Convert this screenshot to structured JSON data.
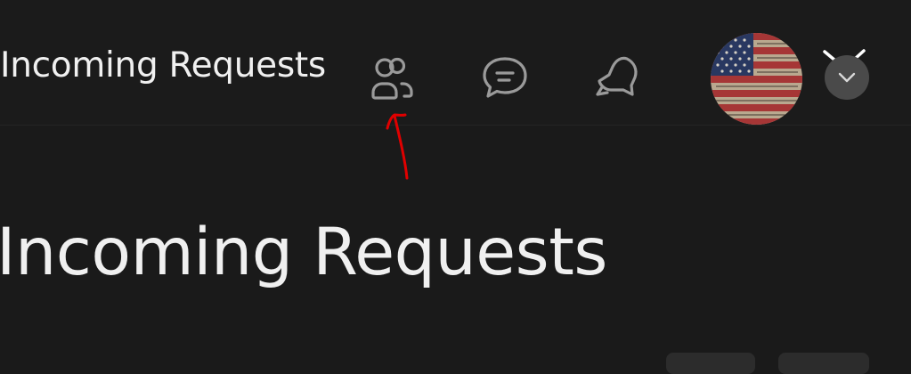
{
  "header": {
    "title": "Incoming Requests",
    "icons": {
      "friends": "friends-icon",
      "chat": "chat-icon",
      "notifications": "bell-icon",
      "avatar": "user-avatar",
      "dropdown": "chevron-down-icon"
    }
  },
  "main": {
    "title": "Incoming Requests"
  },
  "colors": {
    "background": "#1a1a1a",
    "header_background": "#1b1b1b",
    "text": "#f0f0f0",
    "icon": "#9a9a9a",
    "annotation": "#e00000"
  }
}
